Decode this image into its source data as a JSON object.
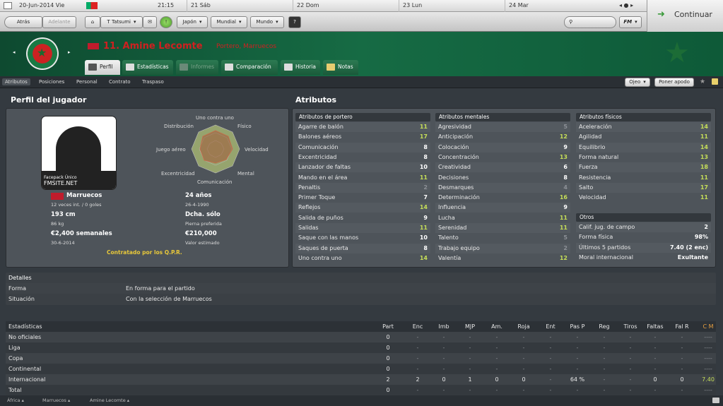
{
  "topbar": {
    "date": "20-Jun-2014 Vie",
    "time": "21:15",
    "days": [
      "21 Sáb",
      "22 Dom",
      "23 Lun",
      "24 Mar"
    ]
  },
  "nav": {
    "back": "Atrás",
    "forward": "Adelante",
    "manager": "T Tatsumi",
    "region1": "Japón",
    "region2": "Mundial",
    "region3": "Mundo",
    "help": "?",
    "fm": "FM",
    "continue": "Continuar"
  },
  "player": {
    "title": "11. Amine Lecomte",
    "subtitle": "Portero, Marruecos"
  },
  "tabs": [
    "Perfil",
    "Estadísticas",
    "Informes",
    "Comparación",
    "Historia",
    "Notas"
  ],
  "subnav": [
    "Atributos",
    "Posiciones",
    "Personal",
    "Contrato",
    "Traspaso"
  ],
  "subnav_right": {
    "scout": "Ojeo",
    "approach": "Poner apodo"
  },
  "profile": {
    "title": "Perfil del jugador",
    "photo_caption": [
      "Facepack Único",
      "FMSITE.NET"
    ],
    "nation": "Marruecos",
    "caps": "12 veces int. / 0 goles",
    "age": "24 años",
    "dob": "26-4-1990",
    "height": "193 cm",
    "weight": "86 kg",
    "foot": "Dcha. sólo",
    "foot_label": "Pierna preferida",
    "wage": "€2,400 semanales",
    "contract_end": "30-6-2014",
    "value": "€210,000",
    "value_label": "Valor estimado",
    "contracted": "Contratado por los Q.P.R.",
    "radar": [
      "Uno contra uno",
      "Físico",
      "Velocidad",
      "Mental",
      "Comunicación",
      "Excentricidad",
      "Juego aéreo",
      "Distribución"
    ]
  },
  "attributes": {
    "title": "Atributos",
    "goalkeeper": {
      "title": "Atributos de portero",
      "rows": [
        [
          "Agarre de balón",
          "11"
        ],
        [
          "Balones aéreos",
          "17"
        ],
        [
          "Comunicación",
          "8"
        ],
        [
          "Excentricidad",
          "8"
        ],
        [
          "Lanzador de faltas",
          "10"
        ],
        [
          "Mando en el área",
          "11"
        ],
        [
          "Penaltis",
          "2"
        ],
        [
          "Primer Toque",
          "7"
        ],
        [
          "Reflejos",
          "14"
        ],
        [
          "Salida de puños",
          "9"
        ],
        [
          "Salidas",
          "11"
        ],
        [
          "Saque con las manos",
          "10"
        ],
        [
          "Saques de puerta",
          "8"
        ],
        [
          "Uno contra uno",
          "14"
        ]
      ]
    },
    "mental": {
      "title": "Atributos mentales",
      "rows": [
        [
          "Agresividad",
          "5"
        ],
        [
          "Anticipación",
          "12"
        ],
        [
          "Colocación",
          "9"
        ],
        [
          "Concentración",
          "13"
        ],
        [
          "Creatividad",
          "6"
        ],
        [
          "Decisiones",
          "8"
        ],
        [
          "Desmarques",
          "4"
        ],
        [
          "Determinación",
          "16"
        ],
        [
          "Influencia",
          "9"
        ],
        [
          "Lucha",
          "11"
        ],
        [
          "Serenidad",
          "11"
        ],
        [
          "Talento",
          "5"
        ],
        [
          "Trabajo equipo",
          "2"
        ],
        [
          "Valentía",
          "12"
        ]
      ]
    },
    "physical": {
      "title": "Atributos físicos",
      "rows": [
        [
          "Aceleración",
          "14"
        ],
        [
          "Agilidad",
          "11"
        ],
        [
          "Equilibrio",
          "14"
        ],
        [
          "Forma natural",
          "13"
        ],
        [
          "Fuerza",
          "18"
        ],
        [
          "Resistencia",
          "11"
        ],
        [
          "Salto",
          "17"
        ],
        [
          "Velocidad",
          "11"
        ]
      ]
    },
    "others": {
      "title": "Otros",
      "rows": [
        [
          "Calif. jug. de campo",
          "2"
        ],
        [
          "Forma física",
          "98%"
        ],
        [
          "Últimos 5 partidos",
          "7.40 (2 enc)"
        ],
        [
          "Moral internacional",
          "Exultante"
        ]
      ]
    }
  },
  "details": {
    "title": "Detalles",
    "rows": [
      [
        "Forma",
        "En forma para el partido"
      ],
      [
        "Situación",
        "Con la selección de Marruecos"
      ]
    ]
  },
  "stats": {
    "title": "Estadísticas",
    "cols": [
      "Part",
      "Enc",
      "Imb",
      "MJP",
      "Am.",
      "Roja",
      "Ent",
      "Pas P",
      "Reg",
      "Tiros",
      "Faltas",
      "Fal R",
      "C M"
    ],
    "rows": [
      [
        "No oficiales",
        "0",
        "-",
        "-",
        "-",
        "-",
        "-",
        "-",
        "-",
        "-",
        "-",
        "-",
        "-",
        "----"
      ],
      [
        "Liga",
        "0",
        "-",
        "-",
        "-",
        "-",
        "-",
        "-",
        "-",
        "-",
        "-",
        "-",
        "-",
        "----"
      ],
      [
        "Copa",
        "0",
        "-",
        "-",
        "-",
        "-",
        "-",
        "-",
        "-",
        "-",
        "-",
        "-",
        "-",
        "----"
      ],
      [
        "Continental",
        "0",
        "-",
        "-",
        "-",
        "-",
        "-",
        "-",
        "-",
        "-",
        "-",
        "-",
        "-",
        "----"
      ],
      [
        "Internacional",
        "2",
        "2",
        "0",
        "1",
        "0",
        "0",
        "-",
        "64 %",
        "-",
        "-",
        "0",
        "0",
        "7.40"
      ],
      [
        "Total",
        "0",
        "-",
        "-",
        "-",
        "-",
        "-",
        "-",
        "-",
        "-",
        "-",
        "-",
        "-",
        "----"
      ]
    ]
  },
  "footer": [
    "África",
    "Marruecos",
    "Amine Lecomte"
  ]
}
